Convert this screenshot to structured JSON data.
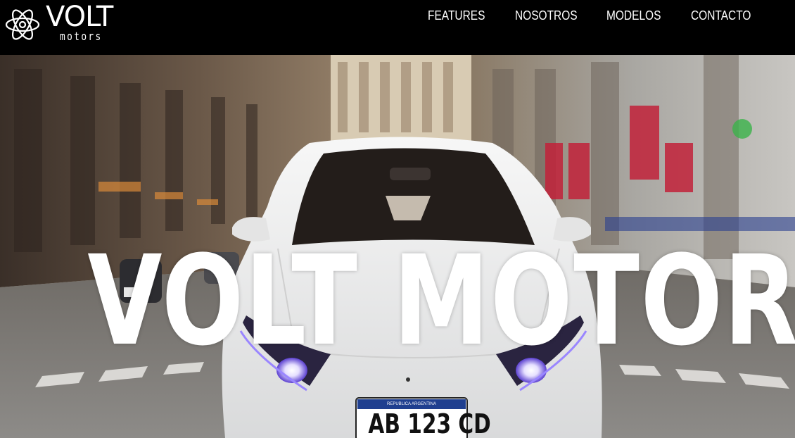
{
  "brand": {
    "name": "VOLT",
    "tagline": "motors",
    "logo_icon": "atom-icon"
  },
  "nav": {
    "items": [
      {
        "label": "FEATURES"
      },
      {
        "label": "NOSOTROS"
      },
      {
        "label": "MODELOS"
      },
      {
        "label": "CONTACTO"
      }
    ]
  },
  "hero": {
    "title": "VOLT MOTORS",
    "plate_country": "REPUBLICA ARGENTINA",
    "plate_number": "AB 123 CD"
  },
  "colors": {
    "nav_background": "#000000",
    "text": "#ffffff",
    "car_body": "#f1f2f2",
    "plate_blue": "#1f3f8f",
    "headlight_glow": "#8a6cff"
  }
}
